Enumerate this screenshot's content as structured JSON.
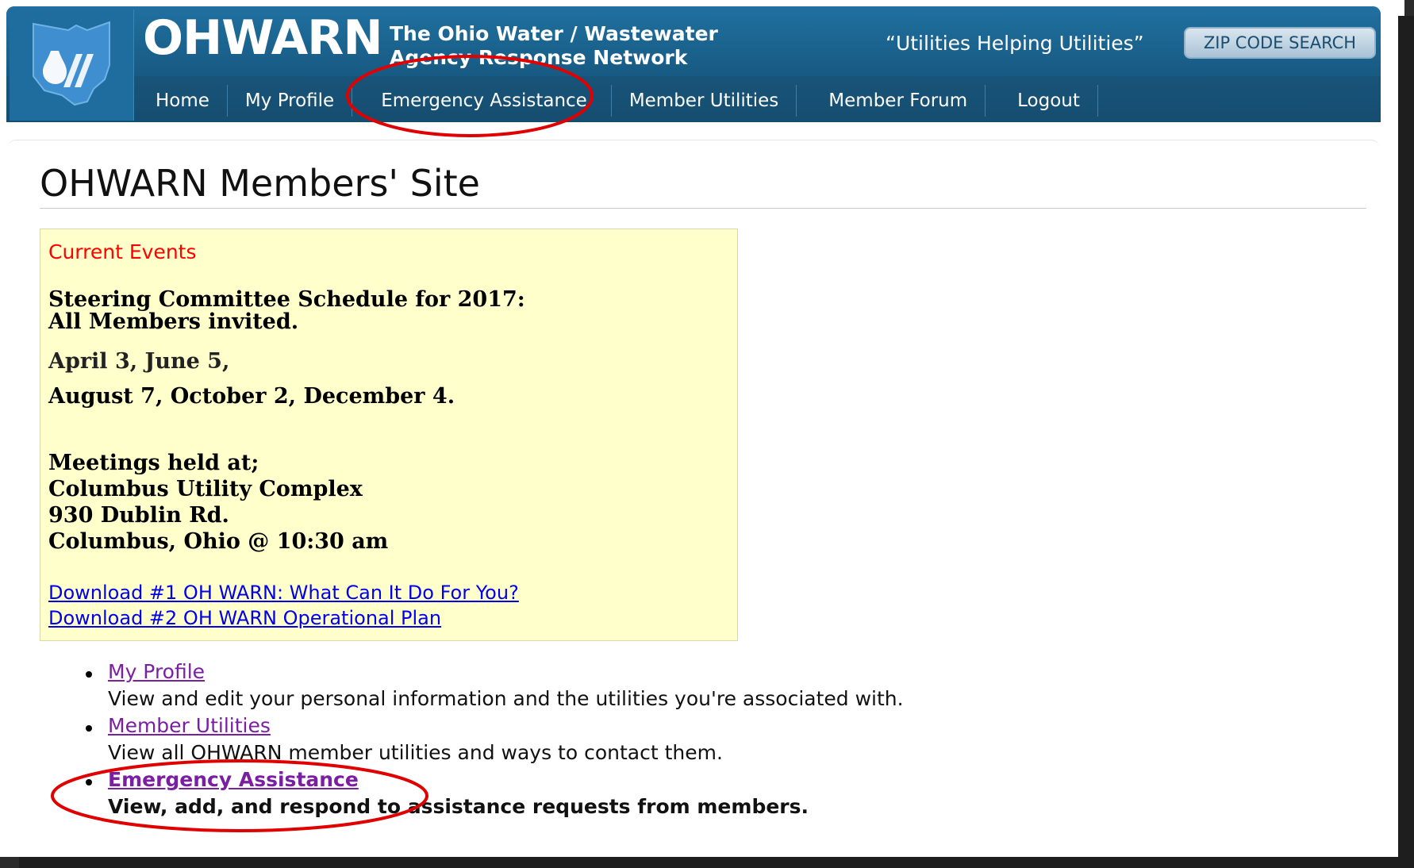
{
  "header": {
    "brand": "OHWARN",
    "subtitle_line1": "The Ohio Water / Wastewater",
    "subtitle_line2": "Agency Response Network",
    "tagline": "“Utilities Helping Utilities”",
    "zip_search_label": "ZIP CODE SEARCH"
  },
  "nav": {
    "items": [
      "Home",
      "My Profile",
      "Emergency Assistance",
      "Member Utilities",
      "Member Forum",
      "Logout"
    ]
  },
  "main": {
    "page_title": "OHWARN Members' Site",
    "events": {
      "heading": "Current Events",
      "schedule_line1": "Steering Committee Schedule for 2017:",
      "schedule_line2": "All Members invited.",
      "dates_line1": "April 3,   June 5,",
      "dates_line2": "August 7,   October 2,    December 4.",
      "venue_line1": "Meetings held at;",
      "venue_line2": "Columbus Utility Complex",
      "venue_line3": "930 Dublin Rd.",
      "venue_line4": "Columbus, Ohio  @ 10:30 am",
      "download1": "Download #1 OH WARN: What Can It Do For You?",
      "download2": "Download #2 OH WARN Operational Plan"
    },
    "links": [
      {
        "label": "My Profile",
        "description": "View and edit your personal information and the utilities you're associated with."
      },
      {
        "label": "Member Utilities",
        "description": "View all OHWARN member utilities and ways to contact them."
      },
      {
        "label": "Emergency Assistance",
        "description": "View, add, and respond to assistance requests from members."
      }
    ]
  },
  "colors": {
    "header_blue": "#1d5f86",
    "events_bg": "#ffffcc",
    "events_heading": "#ff0000",
    "link_blue": "#0000ee",
    "visited_purple": "#7a1fa2",
    "annotation_red": "#e00000"
  },
  "icons": {
    "logo": "ohio-water-drop-logo-icon"
  }
}
